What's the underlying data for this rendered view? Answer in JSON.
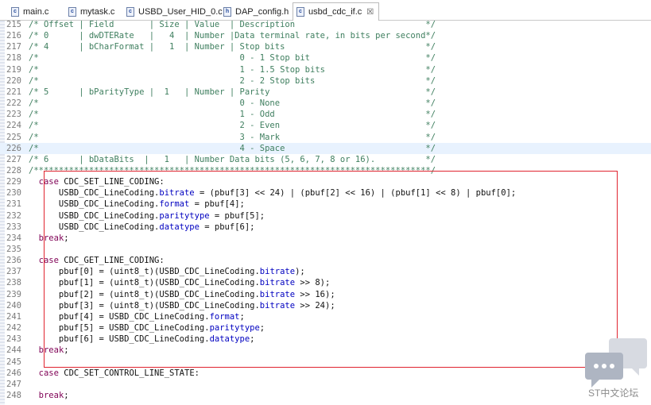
{
  "tabs": [
    {
      "label": "main.c",
      "icon": "c-file-icon",
      "active": false
    },
    {
      "label": "mytask.c",
      "icon": "c-file-icon",
      "active": false
    },
    {
      "label": "USBD_User_HID_0.c",
      "icon": "c-file-icon",
      "active": false
    },
    {
      "label": "DAP_config.h",
      "icon": "h-file-icon",
      "active": false
    },
    {
      "label": "usbd_cdc_if.c",
      "icon": "c-file-icon",
      "active": true,
      "close": "☒"
    }
  ],
  "lines": [
    {
      "n": "215",
      "parts": [
        [
          "c-cm",
          "/* Offset | Field       | Size | Value  | Description                          */"
        ]
      ]
    },
    {
      "n": "216",
      "parts": [
        [
          "c-cm",
          "/* 0      | dwDTERate   |   4  | Number |Data terminal rate, in bits per second*/"
        ]
      ]
    },
    {
      "n": "217",
      "parts": [
        [
          "c-cm",
          "/* 4      | bCharFormat |   1  | Number | Stop bits                            */"
        ]
      ]
    },
    {
      "n": "218",
      "parts": [
        [
          "c-cm",
          "/*                                        0 - 1 Stop bit                       */"
        ]
      ]
    },
    {
      "n": "219",
      "parts": [
        [
          "c-cm",
          "/*                                        1 - 1.5 Stop bits                    */"
        ]
      ]
    },
    {
      "n": "220",
      "parts": [
        [
          "c-cm",
          "/*                                        2 - 2 Stop bits                      */"
        ]
      ]
    },
    {
      "n": "221",
      "parts": [
        [
          "c-cm",
          "/* 5      | bParityType |  1   | Number | Parity                               */"
        ]
      ]
    },
    {
      "n": "222",
      "parts": [
        [
          "c-cm",
          "/*                                        0 - None                             */"
        ]
      ]
    },
    {
      "n": "223",
      "parts": [
        [
          "c-cm",
          "/*                                        1 - Odd                              */"
        ]
      ]
    },
    {
      "n": "224",
      "parts": [
        [
          "c-cm",
          "/*                                        2 - Even                             */"
        ]
      ]
    },
    {
      "n": "225",
      "parts": [
        [
          "c-cm",
          "/*                                        3 - Mark                             */"
        ]
      ]
    },
    {
      "n": "226",
      "parts": [
        [
          "c-cm",
          "/*                                        4 - Space                            */"
        ]
      ],
      "highlight": true
    },
    {
      "n": "227",
      "parts": [
        [
          "c-cm",
          "/* 6      | bDataBits  |   1   | Number Data bits (5, 6, 7, 8 or 16).          */"
        ]
      ]
    },
    {
      "n": "228",
      "parts": [
        [
          "c-cm",
          "/*******************************************************************************/"
        ]
      ]
    },
    {
      "n": "229",
      "parts": [
        [
          "c-plain",
          "  "
        ],
        [
          "c-kw",
          "case"
        ],
        [
          "c-plain",
          " CDC_SET_LINE_CODING:"
        ]
      ]
    },
    {
      "n": "230",
      "parts": [
        [
          "c-plain",
          "      USBD_CDC_LineCoding."
        ],
        [
          "c-field",
          "bitrate"
        ],
        [
          "c-plain",
          " = (pbuf[3] << 24) | (pbuf[2] << 16) | (pbuf[1] << 8) | pbuf[0];"
        ]
      ]
    },
    {
      "n": "231",
      "parts": [
        [
          "c-plain",
          "      USBD_CDC_LineCoding."
        ],
        [
          "c-field",
          "format"
        ],
        [
          "c-plain",
          " = pbuf[4];"
        ]
      ]
    },
    {
      "n": "232",
      "parts": [
        [
          "c-plain",
          "      USBD_CDC_LineCoding."
        ],
        [
          "c-field",
          "paritytype"
        ],
        [
          "c-plain",
          " = pbuf[5];"
        ]
      ]
    },
    {
      "n": "233",
      "parts": [
        [
          "c-plain",
          "      USBD_CDC_LineCoding."
        ],
        [
          "c-field",
          "datatype"
        ],
        [
          "c-plain",
          " = pbuf[6];"
        ]
      ]
    },
    {
      "n": "234",
      "parts": [
        [
          "c-plain",
          "  "
        ],
        [
          "c-kw",
          "break"
        ],
        [
          "c-plain",
          ";"
        ]
      ]
    },
    {
      "n": "235",
      "parts": [
        [
          "c-plain",
          ""
        ]
      ]
    },
    {
      "n": "236",
      "parts": [
        [
          "c-plain",
          "  "
        ],
        [
          "c-kw",
          "case"
        ],
        [
          "c-plain",
          " CDC_GET_LINE_CODING:"
        ]
      ]
    },
    {
      "n": "237",
      "parts": [
        [
          "c-plain",
          "      pbuf[0] = (uint8_t)(USBD_CDC_LineCoding."
        ],
        [
          "c-field",
          "bitrate"
        ],
        [
          "c-plain",
          ");"
        ]
      ]
    },
    {
      "n": "238",
      "parts": [
        [
          "c-plain",
          "      pbuf[1] = (uint8_t)(USBD_CDC_LineCoding."
        ],
        [
          "c-field",
          "bitrate"
        ],
        [
          "c-plain",
          " >> 8);"
        ]
      ]
    },
    {
      "n": "239",
      "parts": [
        [
          "c-plain",
          "      pbuf[2] = (uint8_t)(USBD_CDC_LineCoding."
        ],
        [
          "c-field",
          "bitrate"
        ],
        [
          "c-plain",
          " >> 16);"
        ]
      ]
    },
    {
      "n": "240",
      "parts": [
        [
          "c-plain",
          "      pbuf[3] = (uint8_t)(USBD_CDC_LineCoding."
        ],
        [
          "c-field",
          "bitrate"
        ],
        [
          "c-plain",
          " >> 24);"
        ]
      ]
    },
    {
      "n": "241",
      "parts": [
        [
          "c-plain",
          "      pbuf[4] = USBD_CDC_LineCoding."
        ],
        [
          "c-field",
          "format"
        ],
        [
          "c-plain",
          ";"
        ]
      ]
    },
    {
      "n": "242",
      "parts": [
        [
          "c-plain",
          "      pbuf[5] = USBD_CDC_LineCoding."
        ],
        [
          "c-field",
          "paritytype"
        ],
        [
          "c-plain",
          ";"
        ]
      ]
    },
    {
      "n": "243",
      "parts": [
        [
          "c-plain",
          "      pbuf[6] = USBD_CDC_LineCoding."
        ],
        [
          "c-field",
          "datatype"
        ],
        [
          "c-plain",
          ";"
        ]
      ]
    },
    {
      "n": "244",
      "parts": [
        [
          "c-plain",
          "  "
        ],
        [
          "c-kw",
          "break"
        ],
        [
          "c-plain",
          ";"
        ]
      ]
    },
    {
      "n": "245",
      "parts": [
        [
          "c-plain",
          ""
        ]
      ]
    },
    {
      "n": "246",
      "parts": [
        [
          "c-plain",
          "  "
        ],
        [
          "c-kw",
          "case"
        ],
        [
          "c-plain",
          " CDC_SET_CONTROL_LINE_STATE:"
        ]
      ]
    },
    {
      "n": "247",
      "parts": [
        [
          "c-plain",
          ""
        ]
      ]
    },
    {
      "n": "248",
      "parts": [
        [
          "c-plain",
          "  "
        ],
        [
          "c-kw",
          "break"
        ],
        [
          "c-plain",
          ";"
        ]
      ]
    }
  ],
  "watermark": {
    "text": "ST中文论坛",
    "icon": "chat-bubbles-icon"
  },
  "colors": {
    "comment": "#3f7f5f",
    "keyword": "#7f0055",
    "field": "#0000c0",
    "annotation_box": "#e0242f",
    "current_line": "#e8f2fe"
  }
}
